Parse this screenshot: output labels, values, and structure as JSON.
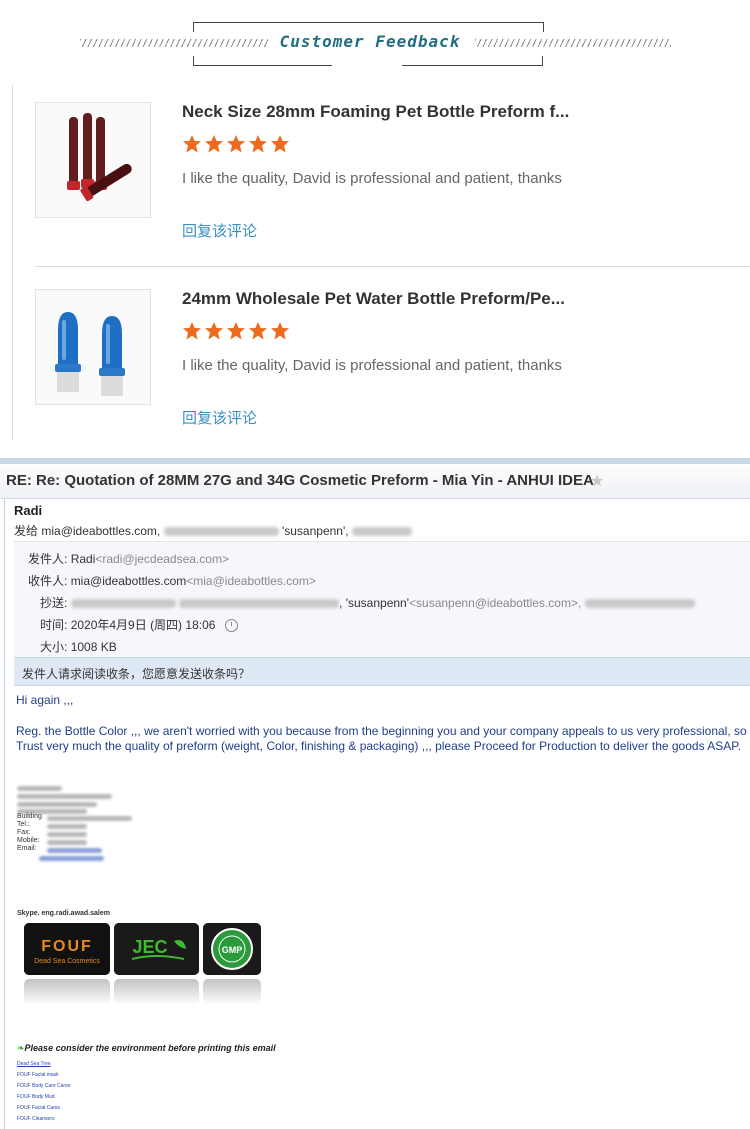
{
  "feedback": {
    "title": "Customer Feedback",
    "items": [
      {
        "product_title": "Neck Size 28mm Foaming Pet Bottle Preform f...",
        "rating": 5,
        "review": "I like the quality, David is professional and patient, thanks",
        "reply_label": "回复该评论"
      },
      {
        "product_title": "24mm Wholesale Pet Water Bottle Preform/Pe...",
        "rating": 5,
        "review": "I like the quality, David is professional and patient, thanks",
        "reply_label": "回复该评论"
      }
    ],
    "colors": {
      "title": "#1f6e82",
      "star": "#ee6a1e",
      "reply": "#3b8fc3"
    }
  },
  "email": {
    "subject": "RE: Re: Quotation of 28MM 27G and 34G Cosmetic Preform - Mia Yin - ANHUI IDEA",
    "sender_name": "Radi",
    "to_prefix": "发给",
    "to_main": "mia@ideabottles.com,",
    "to_second": "'susanpenn',",
    "meta": {
      "from_label": "发件人:",
      "from_name": "Radi",
      "from_addr": "<radi@jecdeadsea.com>",
      "to_label": "收件人:",
      "to_name": "mia@ideabottles.com",
      "to_addr": "<mia@ideabottles.com>",
      "cc_label": "抄送:",
      "cc_name": "'susanpenn'",
      "cc_addr": "<susanpenn@ideabottles.com>,",
      "time_label": "时间:",
      "time_value": "2020年4月9日 (周四) 18:06",
      "size_label": "大小:",
      "size_value": "1008 KB"
    },
    "receipt_prompt": "发件人请求阅读收条，您愿意发送收条吗？",
    "greeting": "Hi again ,,,",
    "body_line1": "Reg. the Bottle Color ,,, we aren't worried with you because from the beginning you and your company appeals to us very professional, so we",
    "body_line2": "Trust very much the quality of preform (weight, Color, finishing & packaging)  ,,, please Proceed for Production to deliver the goods ASAP.",
    "signature": {
      "labels": [
        "Building",
        "Tel.:",
        "Fax:",
        "Mobile:",
        "Email:"
      ],
      "skype": "Skype.    eng.radi.awad.salem",
      "logos": [
        {
          "name": "FOUF",
          "subtitle": "Dead Sea Cosmetics"
        },
        {
          "name": "JEC"
        },
        {
          "name": "GMP"
        }
      ],
      "env_note": "Please consider the environment before printing this email",
      "links": [
        "Dead Sea Tree",
        "FOUF Facial mask",
        "FOUF Body Care Cares",
        "FOUF Body Mud",
        "FOUF Facial Cares",
        "FOUF Cleansers"
      ]
    }
  }
}
